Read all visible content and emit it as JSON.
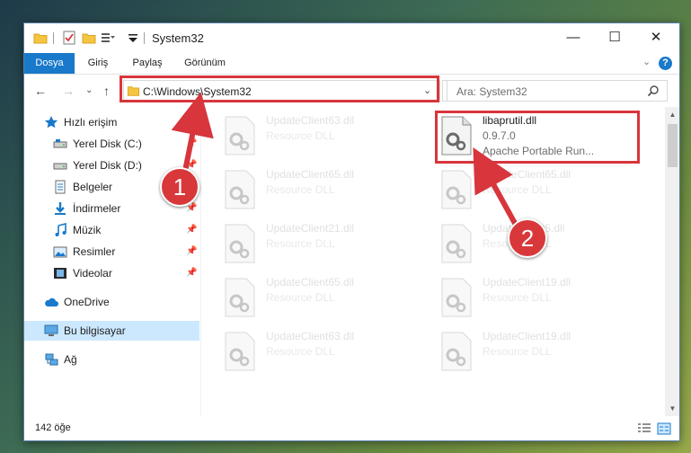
{
  "window": {
    "title": "System32",
    "controls": {
      "minimize": "—",
      "maximize": "☐",
      "close": "✕"
    }
  },
  "ribbon": {
    "tabs": [
      {
        "label": "Dosya"
      },
      {
        "label": "Giriş"
      },
      {
        "label": "Paylaş"
      },
      {
        "label": "Görünüm"
      }
    ],
    "expand_icon": "⌄",
    "help_icon": "?"
  },
  "navigation": {
    "back": "←",
    "forward": "→",
    "recent": "⌄",
    "up": "↑",
    "address": "C:\\Windows\\System32",
    "address_dropdown": "⌄",
    "refresh": "↻",
    "search_placeholder": "Ara: System32"
  },
  "sidebar": {
    "items": [
      {
        "label": "Hızlı erişim",
        "icon": "star-icon"
      },
      {
        "label": "Yerel Disk (C:)",
        "icon": "drive-icon",
        "pinned": true
      },
      {
        "label": "Yerel Disk (D:)",
        "icon": "drive-icon",
        "pinned": true
      },
      {
        "label": "Belgeler",
        "icon": "documents-icon",
        "pinned": true
      },
      {
        "label": "İndirmeler",
        "icon": "downloads-icon",
        "pinned": true
      },
      {
        "label": "Müzik",
        "icon": "music-icon",
        "pinned": true
      },
      {
        "label": "Resimler",
        "icon": "pictures-icon",
        "pinned": true
      },
      {
        "label": "Videolar",
        "icon": "videos-icon",
        "pinned": true
      },
      {
        "label": "OneDrive",
        "icon": "cloud-icon"
      },
      {
        "label": "Bu bilgisayar",
        "icon": "computer-icon",
        "selected": true
      },
      {
        "label": "Ağ",
        "icon": "network-icon"
      }
    ],
    "pin_glyph": "📌"
  },
  "files": [
    {
      "name": "UpdateClient63.dll",
      "desc": "Resource DLL"
    },
    {
      "name": "libaprutil.dll",
      "version": "0.9.7.0",
      "desc": "Apache Portable Run...",
      "highlighted": true
    },
    {
      "name": "UpdateClient65.dll",
      "desc": "Resource DLL"
    },
    {
      "name": "UpdateClient65.dll",
      "desc": "Resource DLL"
    },
    {
      "name": "UpdateClient21.dll",
      "desc": "Resource DLL"
    },
    {
      "name": "UpdateClient5.dll",
      "desc": "Resource DLL"
    },
    {
      "name": "UpdateClient65.dll",
      "desc": "Resource DLL"
    },
    {
      "name": "UpdateClient19.dll",
      "desc": "Resource DLL"
    },
    {
      "name": "UpdateClient63.dll",
      "desc": "Resource DLL"
    },
    {
      "name": "UpdateClient19.dll",
      "desc": "Resource DLL"
    }
  ],
  "status": {
    "item_count": "142 öğe"
  },
  "annotations": [
    {
      "label": "1"
    },
    {
      "label": "2"
    }
  ],
  "colors": {
    "accent": "#1979ca",
    "annotation_red": "#d8353c",
    "selected_bg": "#cce8ff",
    "folder_yellow": "#f5c542"
  }
}
